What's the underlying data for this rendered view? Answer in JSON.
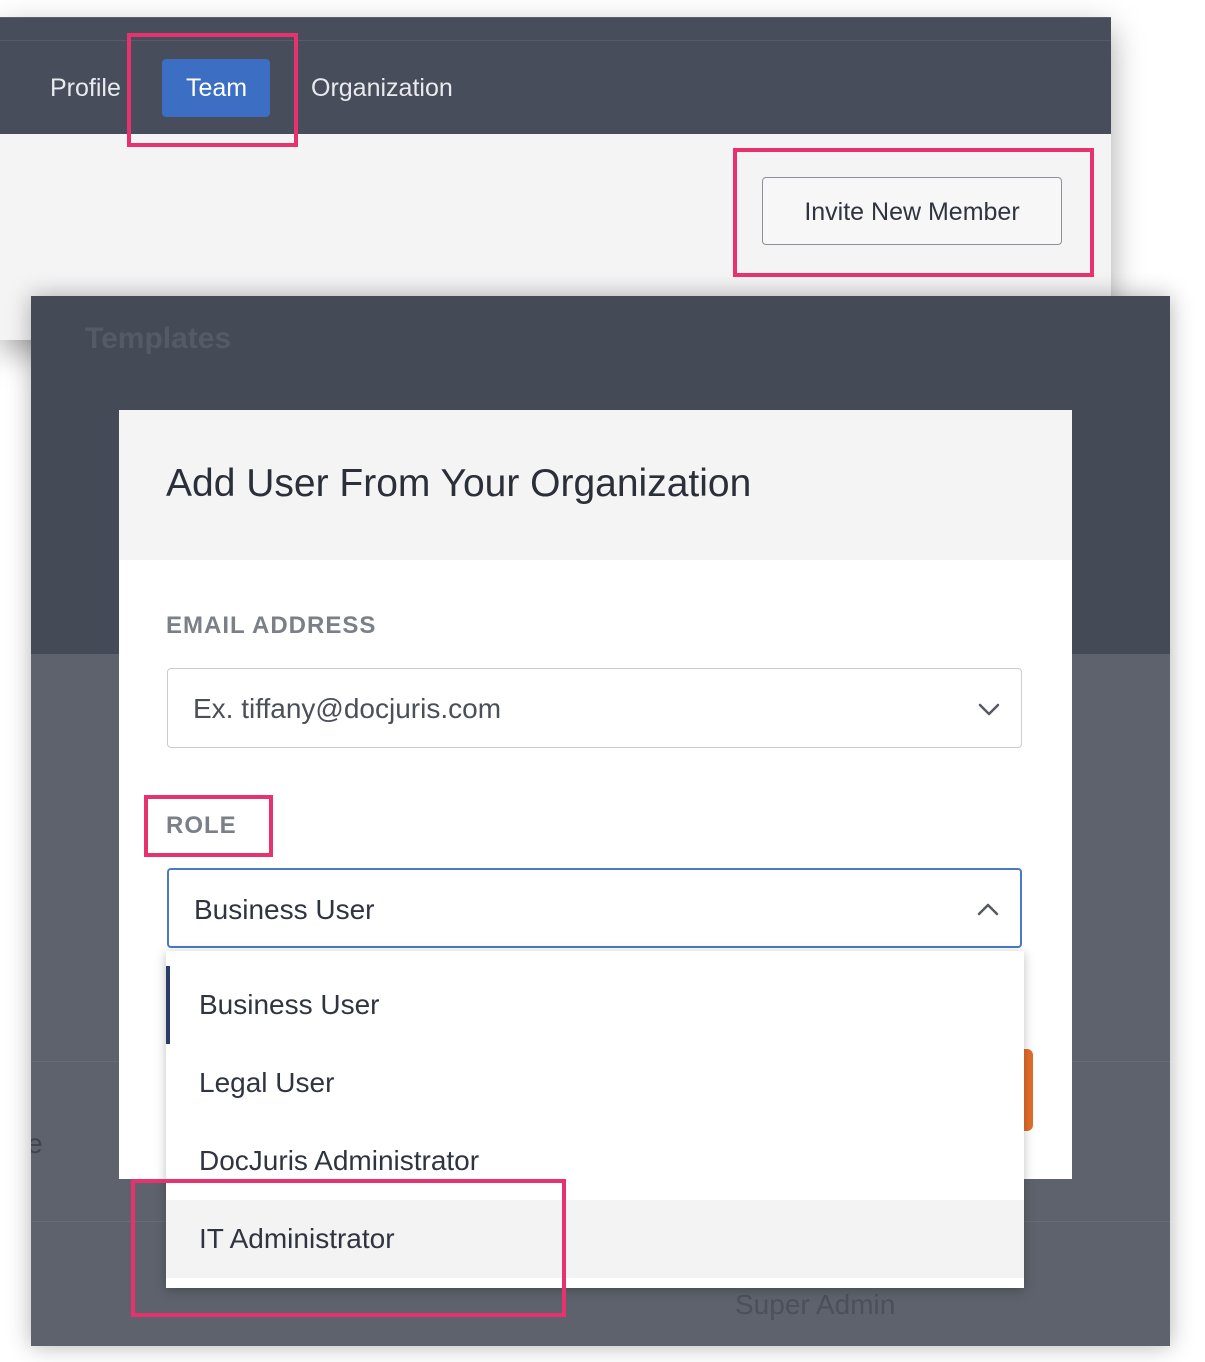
{
  "tabs": {
    "profile": "Profile",
    "team": "Team",
    "organization": "Organization"
  },
  "invite_button_label": "Invite New Member",
  "background": {
    "section_title": "Templates",
    "partial_text": "e",
    "role_cell": "Super Admin"
  },
  "modal": {
    "title": "Add User From Your Organization",
    "email_label": "EMAIL ADDRESS",
    "email_placeholder": "Ex. tiffany@docjuris.com",
    "role_label": "ROLE",
    "role_selected": "Business User",
    "role_options": [
      "Business User",
      "Legal User",
      "DocJuris Administrator",
      "IT Administrator"
    ]
  },
  "colors": {
    "tab_active": "#3c6fc4",
    "highlight": "#e8326e",
    "focus_border": "#4a7ac6",
    "accent_orange": "#e26d2a"
  }
}
